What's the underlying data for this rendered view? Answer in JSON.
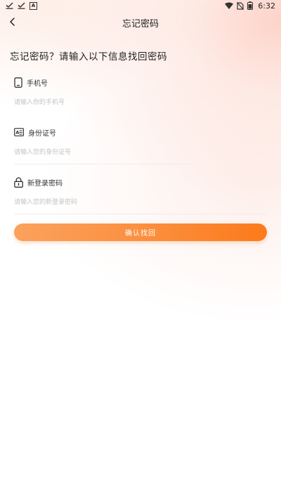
{
  "status_bar": {
    "time": "6:32",
    "battery_level": "6",
    "left_icons": [
      "download-done-icon",
      "download-done-icon",
      "a-notification-icon"
    ],
    "right_icons": [
      "wifi-icon",
      "no-sim-icon",
      "battery-icon"
    ]
  },
  "nav": {
    "back_icon": "chevron-left-icon",
    "title": "忘记密码"
  },
  "heading": "忘记密码？请输入以下信息找回密码",
  "form": {
    "phone": {
      "icon": "phone-icon",
      "label": "手机号",
      "placeholder": "请输入你的手机号",
      "value": ""
    },
    "id_card": {
      "icon": "id-card-icon",
      "label": "身份证号",
      "placeholder": "请输入您的身份证号",
      "value": ""
    },
    "new_password": {
      "icon": "lock-icon",
      "label": "新登录密码",
      "placeholder": "请输入您的新登录密码",
      "value": ""
    },
    "submit_label": "确认找回"
  },
  "colors": {
    "accent_start": "#fba25d",
    "accent_end": "#fc7a1b",
    "background_tint": "#fcc4b6",
    "placeholder": "#c4c4c4",
    "text": "#222222"
  }
}
